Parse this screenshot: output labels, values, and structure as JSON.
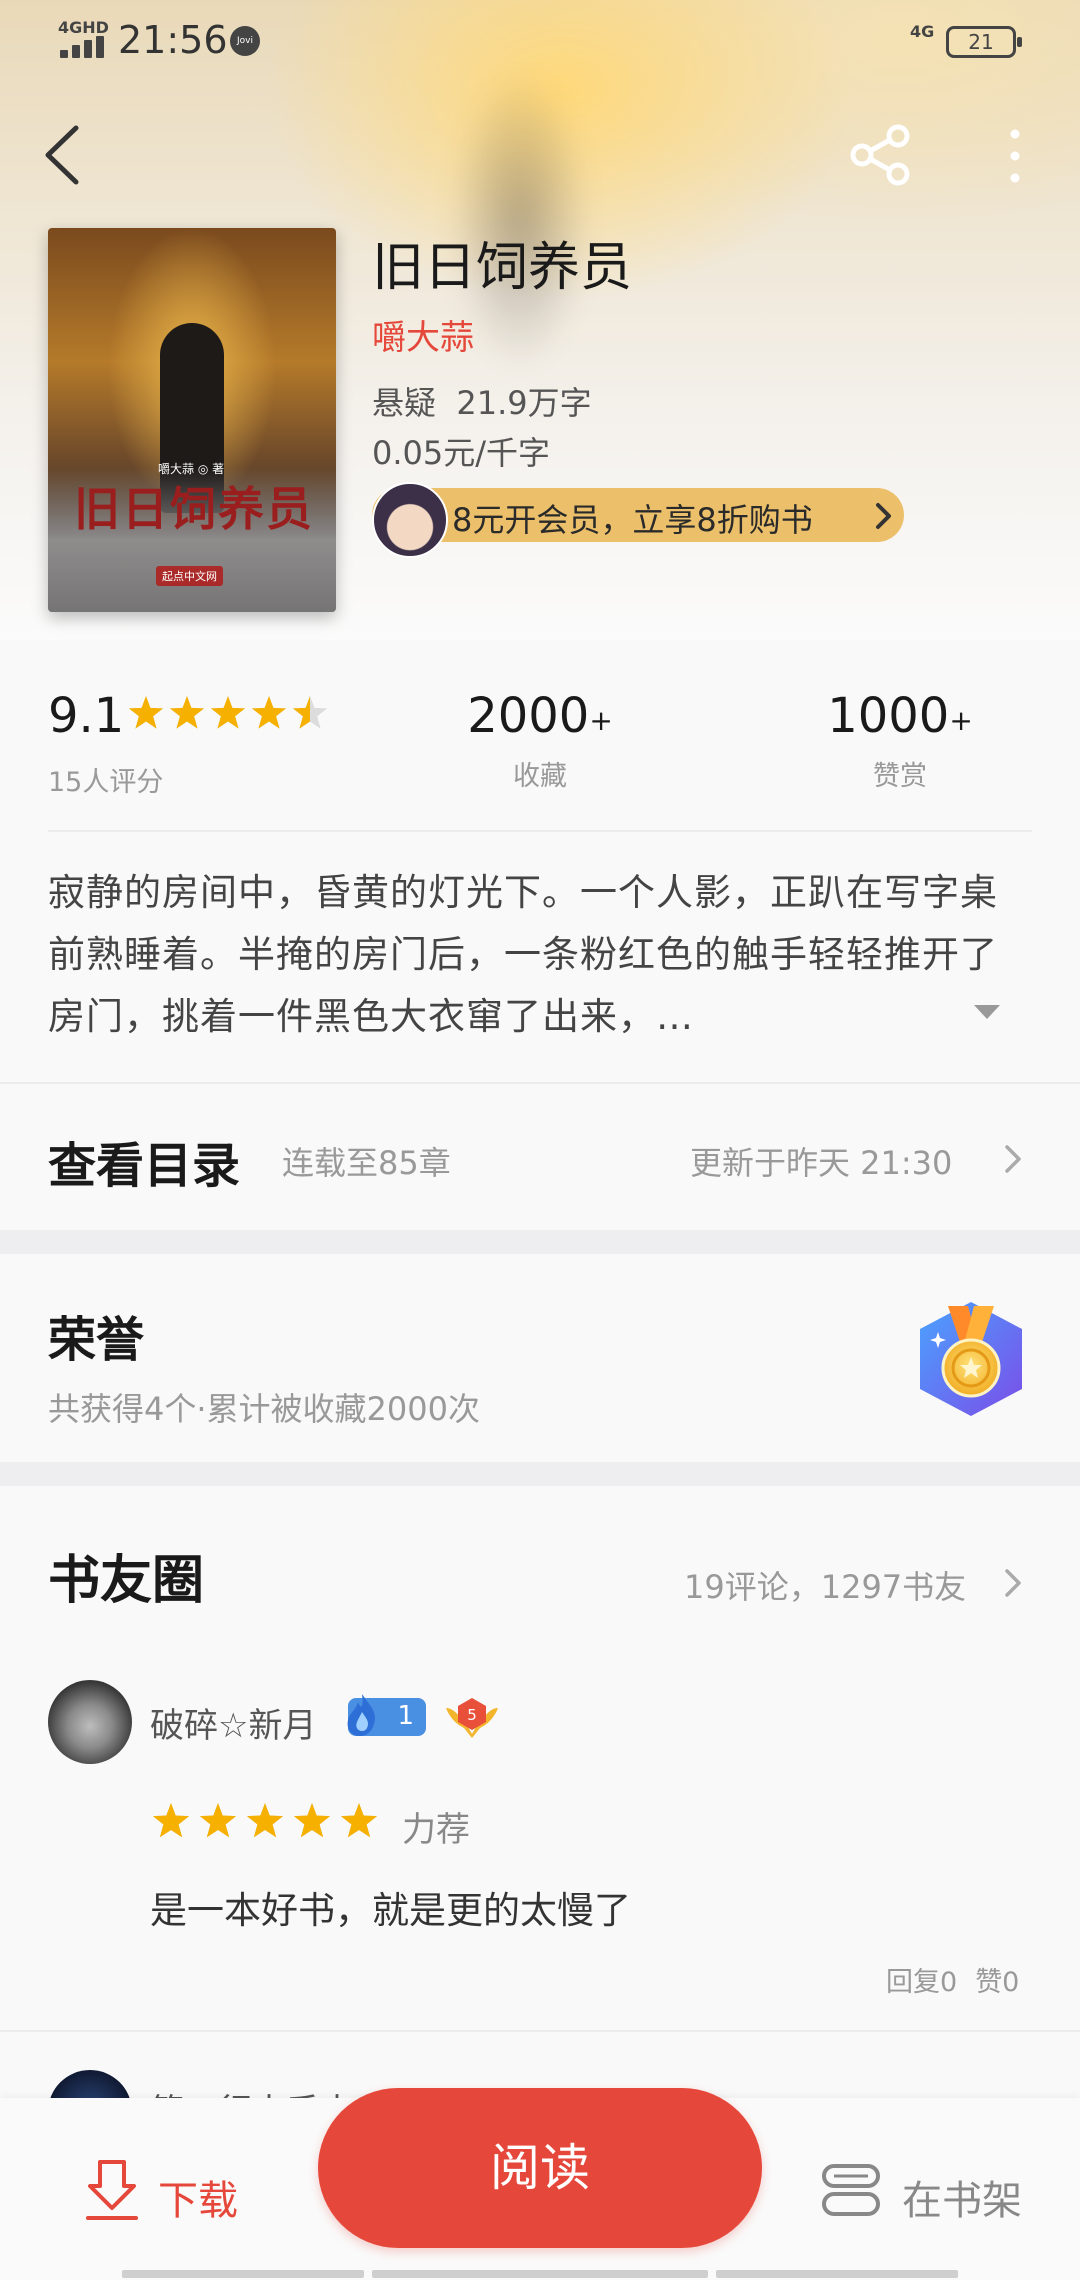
{
  "status_bar": {
    "network": "4GHD",
    "time": "21:56",
    "app_badge": "Jovi",
    "network_right": "4G",
    "battery": "21"
  },
  "book": {
    "title": "旧日饲养员",
    "author": "嚼大蒜",
    "genre": "悬疑",
    "word_count": "21.9万字",
    "price": "0.05元/千字",
    "cover_title": "旧日饲养员",
    "cover_author": "嚼大蒜 ◎ 著",
    "cover_publisher": "起点中文网"
  },
  "vip_banner": {
    "text": "8元开会员，立享8折购书"
  },
  "stats": {
    "rating": "9.1",
    "rating_stars": 4.5,
    "rating_count": "15人评分",
    "favorites_value": "2000",
    "favorites_plus": "+",
    "favorites_label": "收藏",
    "rewards_value": "1000",
    "rewards_plus": "+",
    "rewards_label": "赞赏"
  },
  "synopsis": "寂静的房间中，昏黄的灯光下。一个人影，正趴在写字桌前熟睡着。半掩的房门后，一条粉红色的触手轻轻推开了房门，挑着一件黑色大衣窜了出来，…",
  "toc": {
    "title": "查看目录",
    "serial": "连载至85章",
    "updated": "更新于昨天 21:30"
  },
  "honor": {
    "title": "荣誉",
    "summary": "共获得4个·累计被收藏2000次"
  },
  "circle": {
    "title": "书友圈",
    "stats": "19评论，1297书友"
  },
  "review": {
    "user": "破碎☆新月",
    "level": "1",
    "rank": "5",
    "stars": 5,
    "tag": "力荐",
    "text": "是一本好书，就是更的太慢了",
    "reply": "回复0",
    "like": "赞0"
  },
  "next_review": {
    "user_partial": "第一行大手大"
  },
  "bottom_bar": {
    "download_label": "下载",
    "read_label": "阅读",
    "shelf_label": "在书架"
  },
  "colors": {
    "accent": "#e5473a",
    "vip": "#ecc06b",
    "star": "#f5b000"
  }
}
